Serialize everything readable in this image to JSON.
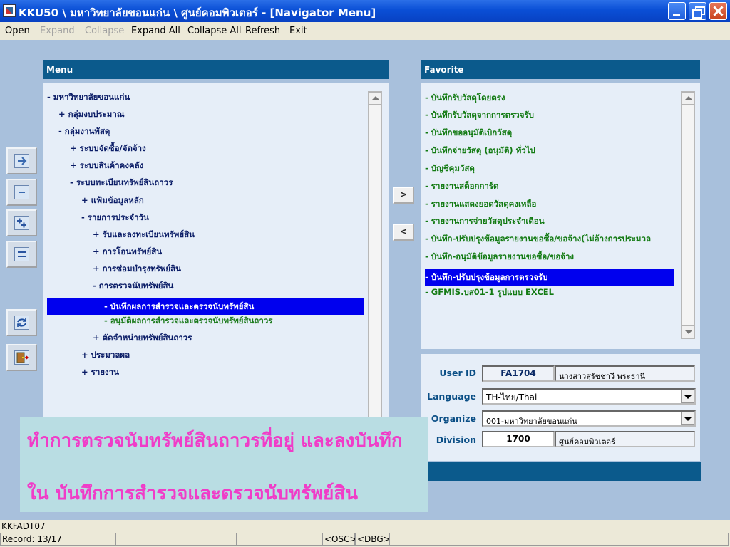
{
  "window": {
    "title": "KKU50 \\ มหาวิทยาลัยขอนแก่น \\ ศูนย์คอมพิวเตอร์ - [Navigator Menu]"
  },
  "menubar": [
    {
      "label": "Open",
      "enabled": true
    },
    {
      "label": "Expand",
      "enabled": false
    },
    {
      "label": "Collapse",
      "enabled": false
    },
    {
      "label": "Expand All",
      "enabled": true
    },
    {
      "label": "Collapse All",
      "enabled": true
    },
    {
      "label": "Refresh",
      "enabled": true
    },
    {
      "label": "Exit",
      "enabled": true
    }
  ],
  "menu_panel": {
    "title": "Menu",
    "items": [
      {
        "text": "- มหาวิทยาลัยขอนแก่น"
      },
      {
        "text": "+ กลุ่มงบประมาณ"
      },
      {
        "text": "- กลุ่มงานพัสดุ"
      },
      {
        "text": "+ ระบบจัดซื้อ/จัดจ้าง"
      },
      {
        "text": "+ ระบบสินค้าคงคลัง"
      },
      {
        "text": "- ระบบทะเบียนทรัพย์สินถาวร"
      },
      {
        "text": "+ แฟ้มข้อมูลหลัก"
      },
      {
        "text": "- รายการประจำวัน"
      },
      {
        "text": "+ รับและลงทะเบียนทรัพย์สิน"
      },
      {
        "text": "+ การโอนทรัพย์สิน"
      },
      {
        "text": "+ การซ่อมบำรุงทรัพย์สิน"
      },
      {
        "text": "- การตรวจนับทรัพย์สิน"
      },
      {
        "text": "- บันทึกผลการสำรวจและตรวจนับทรัพย์สิน"
      },
      {
        "text": "- อนุมัติผลการสำรวจและตรวจนับทรัพย์สินถาวร"
      },
      {
        "text": "+ ตัดจำหน่ายทรัพย์สินถาวร"
      },
      {
        "text": "+ ประมวลผล"
      },
      {
        "text": "+ รายงาน"
      }
    ]
  },
  "favorite_panel": {
    "title": "Favorite",
    "items": [
      {
        "text": "- บันทึกรับวัสดุโดยตรง"
      },
      {
        "text": "- บันทึกรับวัสดุจากการตรวจรับ"
      },
      {
        "text": "- บันทึกขออนุมัติเบิกวัสดุ"
      },
      {
        "text": "- บันทึกจ่ายวัสดุ (อนุมัติ) ทั่วไป"
      },
      {
        "text": "- บัญชีคุมวัสดุ"
      },
      {
        "text": "- รายงานสต็อกการ์ด"
      },
      {
        "text": "- รายงานแสดงยอดวัสดุคงเหลือ"
      },
      {
        "text": "- รายงานการจ่ายวัสดุประจำเดือน"
      },
      {
        "text": "- บันทึก-ปรับปรุงข้อมูลรายงานขอซื้อ/ขอจ้าง(ไม่อ้างการประมวล"
      },
      {
        "text": "- บันทึก-อนุมัติข้อมูลรายงานขอซื้อ/ขอจ้าง"
      },
      {
        "text": "- บันทึก-ปรับปรุงข้อมูลการตรวจรับ"
      },
      {
        "text": "- GFMIS.บส01-1 รูปแบบ EXCEL"
      }
    ]
  },
  "move_buttons": {
    "add": ">",
    "remove": "<"
  },
  "user_info": {
    "user_id_label": "User ID",
    "user_id": "FA1704",
    "user_name": "นางสาวสุรัชชาวี พระธานี",
    "language_label": "Language",
    "language": "TH-ไทย/Thai",
    "organize_label": "Organize",
    "organize": "001-มหาวิทยาลัยขอนแก่น",
    "division_label": "Division",
    "division_code": "1700",
    "division_name": "ศูนย์คอมพิวเตอร์"
  },
  "callout": {
    "line1": "ทำการตรวจนับทรัพย์สินถาวรที่อยู่ และลงบันทึก",
    "line2": "ใน บันทึกการสำรวจและตรวจนับทรัพย์สิน"
  },
  "status": {
    "form_code": "KKFADT07",
    "record": "Record: 13/17",
    "osc": "<OSC>",
    "dbg": "<DBG>"
  },
  "colors": {
    "panel_header": "#0b5a8c",
    "selection": "#0000ee",
    "tree_text": "#0a1c66",
    "leaf_text": "#1b7a1b",
    "callout_text": "#f03cc8",
    "callout_bg": "#b9dde3"
  }
}
